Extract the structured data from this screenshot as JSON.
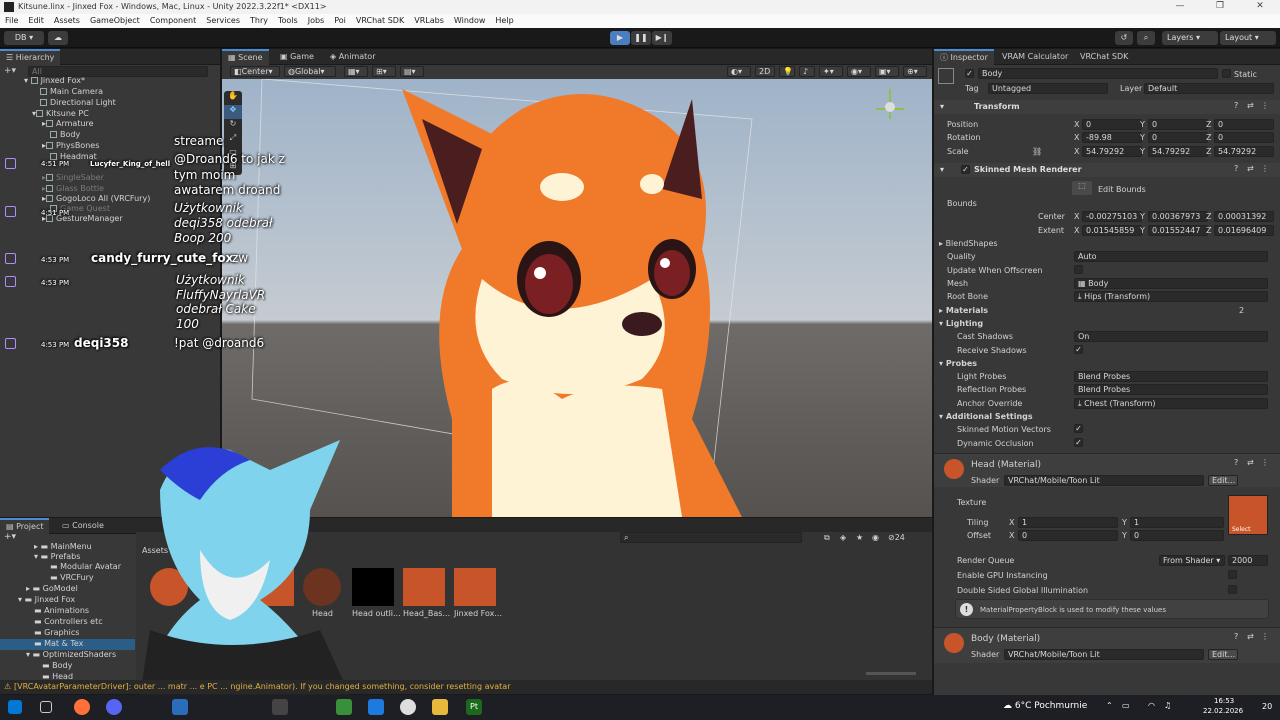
{
  "window": {
    "title": "Kitsune.linx - Jinxed Fox - Windows, Mac, Linux - Unity 2022.3.22f1* <DX11>"
  },
  "menu": [
    "File",
    "Edit",
    "Assets",
    "GameObject",
    "Component",
    "Services",
    "Thry",
    "Tools",
    "Jobs",
    "Poi",
    "VRChat SDK",
    "VRLabs",
    "Window",
    "Help"
  ],
  "toolbar": {
    "account": "DB",
    "layers": "Layers",
    "layout": "Layout"
  },
  "hierarchy": {
    "tab": "Hierarchy",
    "search_placeholder": "All",
    "items": [
      {
        "label": "Jinxed Fox*"
      },
      {
        "label": "Main Camera"
      },
      {
        "label": "Directional Light"
      },
      {
        "label": "Kitsune PC"
      },
      {
        "label": "Armature"
      },
      {
        "label": "Body"
      },
      {
        "label": "PhysBones"
      },
      {
        "label": "Headmat"
      },
      {
        "label": "SingleSaber"
      },
      {
        "label": "Glass Bottle"
      },
      {
        "label": "GogoLoco All (VRCFury)"
      },
      {
        "label": "Game Quest"
      },
      {
        "label": "GestureManager"
      }
    ]
  },
  "scene": {
    "tabs": [
      "Scene",
      "Game",
      "Animator"
    ],
    "pivot": "Center",
    "space": "Global",
    "mode2d": "2D"
  },
  "chat": [
    {
      "time": "",
      "user": "",
      "text": "streame"
    },
    {
      "time": "4:51 PM",
      "user": "Lucyfer_King_of_hell",
      "text": "@Droand6 to jak z"
    },
    {
      "time": "",
      "user": "",
      "text": "tym moim"
    },
    {
      "time": "",
      "user": "",
      "text": "awatarem droand"
    },
    {
      "time": "4:51 PM",
      "user": "",
      "text": "Użytkownik"
    },
    {
      "time": "",
      "user": "",
      "text": "deqi358 odebrał"
    },
    {
      "time": "",
      "user": "",
      "text": "Boop 200"
    },
    {
      "time": "4:53 PM",
      "user": "candy_furry_cute_fox",
      "text": "zw"
    },
    {
      "time": "4:53 PM",
      "user": "",
      "text": "Użytkownik"
    },
    {
      "time": "",
      "user": "",
      "text": "FluffyNayrlaVR"
    },
    {
      "time": "",
      "user": "",
      "text": "odebrał Cake"
    },
    {
      "time": "",
      "user": "",
      "text": "100"
    },
    {
      "time": "4:53 PM",
      "user": "deqi358",
      "text": "!pat @droand6"
    }
  ],
  "inspector": {
    "tabs": [
      "Inspector",
      "VRAM Calculator",
      "VRChat SDK"
    ],
    "object_name": "Body",
    "static_label": "Static",
    "tag_label": "Tag",
    "tag_value": "Untagged",
    "layer_label": "Layer",
    "layer_value": "Default",
    "transform": {
      "title": "Transform",
      "position_label": "Position",
      "rotation_label": "Rotation",
      "scale_label": "Scale",
      "position": [
        "0",
        "0",
        "0"
      ],
      "rotation": [
        "-89.98",
        "0",
        "0"
      ],
      "scale": [
        "54.79292",
        "54.79292",
        "54.79292"
      ]
    },
    "smr": {
      "title": "Skinned Mesh Renderer",
      "edit_bounds": "Edit Bounds",
      "bounds_label": "Bounds",
      "center_label": "Center",
      "extent_label": "Extent",
      "center": [
        "-0.00275103",
        "0.00367973",
        "0.00031392"
      ],
      "extent": [
        "0.01545859",
        "0.01552447",
        "0.01696409"
      ],
      "blendshapes": "BlendShapes",
      "quality_label": "Quality",
      "quality_value": "Auto",
      "update_offscreen": "Update When Offscreen",
      "mesh_label": "Mesh",
      "mesh_value": "Body",
      "root_bone_label": "Root Bone",
      "root_bone_value": "Hips (Transform)",
      "materials_label": "Materials",
      "materials_count": "2",
      "lighting": "Lighting",
      "cast_shadows_label": "Cast Shadows",
      "cast_shadows_value": "On",
      "receive_shadows": "Receive Shadows",
      "probes": "Probes",
      "light_probes_label": "Light Probes",
      "light_probes_value": "Blend Probes",
      "reflection_probes_label": "Reflection Probes",
      "reflection_probes_value": "Blend Probes",
      "anchor_override_label": "Anchor Override",
      "anchor_override_value": "Chest (Transform)",
      "additional": "Additional Settings",
      "skinned_motion": "Skinned Motion Vectors",
      "dynamic_occlusion": "Dynamic Occlusion"
    },
    "material1": {
      "name": "Head (Material)",
      "shader_label": "Shader",
      "shader_value": "VRChat/Mobile/Toon Lit",
      "edit": "Edit...",
      "texture_label": "Texture",
      "tiling_label": "Tiling",
      "offset_label": "Offset",
      "tiling": [
        "1",
        "1"
      ],
      "offset": [
        "0",
        "0"
      ],
      "select": "Select",
      "render_queue_label": "Render Queue",
      "render_queue_mode": "From Shader",
      "render_queue_value": "2000",
      "gpu_instancing": "Enable GPU Instancing",
      "double_sided_gi": "Double Sided Global Illumination",
      "info": "MaterialPropertyBlock is used to modify these values"
    },
    "material2": {
      "name": "Body (Material)",
      "shader_label": "Shader",
      "shader_value": "VRChat/Mobile/Toon Lit",
      "edit": "Edit..."
    }
  },
  "project": {
    "tabs": [
      "Project",
      "Console"
    ],
    "tree": [
      "MainMenu",
      "Prefabs",
      "Modular Avatar",
      "VRCFury",
      "GoModel",
      "Jinxed Fox",
      "Animations",
      "Controllers etc",
      "Graphics",
      "Mat & Tex",
      "OptimizedShaders",
      "Body",
      "Head"
    ],
    "breadcrumb": "Assets",
    "assets": [
      {
        "label": ""
      },
      {
        "label": ""
      },
      {
        "label": ""
      },
      {
        "label": "Head"
      },
      {
        "label": "Head outli..."
      },
      {
        "label": "Head_Bas..."
      },
      {
        "label": "Jinxed Fox..."
      }
    ],
    "count": "24"
  },
  "status": {
    "message": "[VRCAvatarParameterDriver]: outer ... matr ... e PC ... ngine.Animator). If you changed something, consider resetting avatar"
  },
  "taskbar": {
    "weather": "6°C  Pochmurnie",
    "time": "16:53",
    "date": "22.02.2026",
    "notif": "20"
  }
}
